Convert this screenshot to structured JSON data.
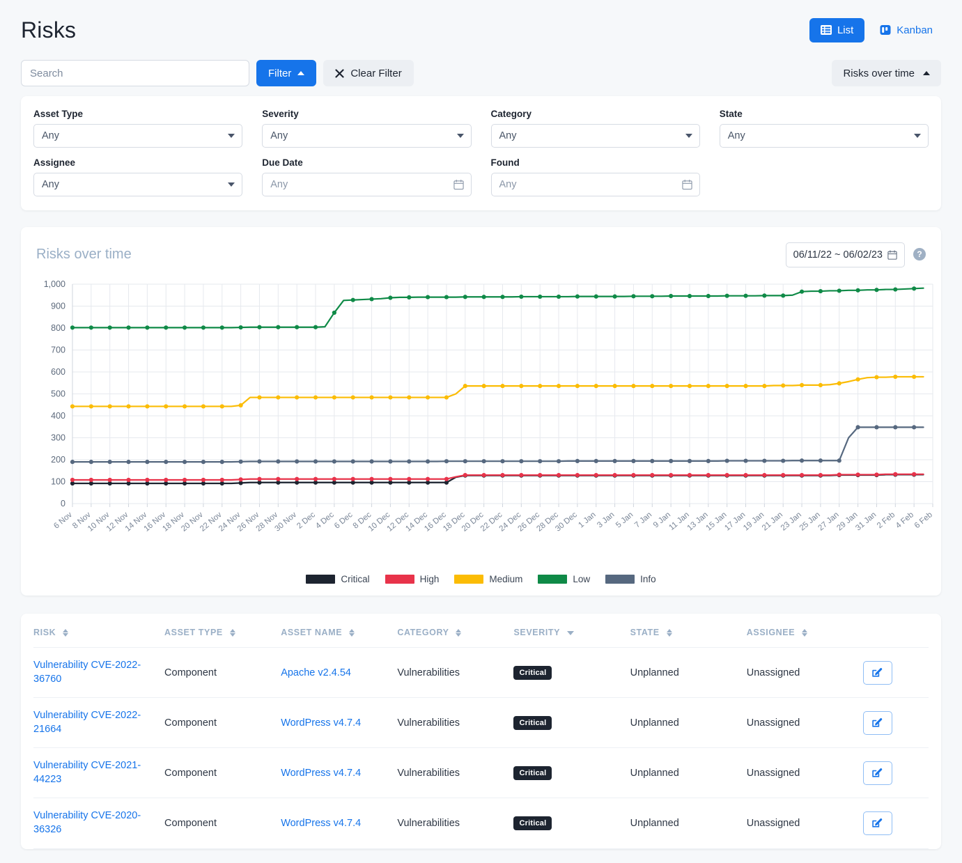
{
  "header": {
    "title": "Risks",
    "views": [
      {
        "label": "List",
        "icon": "list-icon",
        "active": true
      },
      {
        "label": "Kanban",
        "icon": "kanban-icon",
        "active": false
      }
    ]
  },
  "toolbar": {
    "search_placeholder": "Search",
    "search_value": "",
    "filter_label": "Filter",
    "clear_filter_label": "Clear Filter",
    "clear_icon": "close-icon",
    "rotation_label": "Risks over time"
  },
  "filters": [
    {
      "label": "Asset Type",
      "value": "Any",
      "control": "select"
    },
    {
      "label": "Severity",
      "value": "Any",
      "control": "select"
    },
    {
      "label": "Category",
      "value": "Any",
      "control": "select"
    },
    {
      "label": "State",
      "value": "Any",
      "control": "select"
    },
    {
      "label": "Assignee",
      "value": "Any",
      "control": "select"
    },
    {
      "label": "Due Date",
      "value": "Any",
      "control": "date"
    },
    {
      "label": "Found",
      "value": "Any",
      "control": "date"
    }
  ],
  "chart_panel": {
    "title": "Risks over time",
    "date_range": "06/11/22 ~ 06/02/23",
    "calendar_icon": "calendar-icon",
    "help_icon": "help-icon",
    "help_glyph": "?"
  },
  "chart_data": {
    "type": "line",
    "title": "Risks over time",
    "xlabel": "",
    "ylabel": "",
    "ylim": [
      0,
      1000
    ],
    "ytick_labels": [
      "0",
      "100",
      "200",
      "300",
      "400",
      "500",
      "600",
      "700",
      "800",
      "900",
      "1,000"
    ],
    "yticks": [
      0,
      100,
      200,
      300,
      400,
      500,
      600,
      700,
      800,
      900,
      1000
    ],
    "grid": true,
    "legend_position": "bottom",
    "x": [
      "6 Nov",
      "7 Nov",
      "8 Nov",
      "9 Nov",
      "10 Nov",
      "11 Nov",
      "12 Nov",
      "13 Nov",
      "14 Nov",
      "15 Nov",
      "16 Nov",
      "17 Nov",
      "18 Nov",
      "19 Nov",
      "20 Nov",
      "21 Nov",
      "22 Nov",
      "23 Nov",
      "24 Nov",
      "25 Nov",
      "26 Nov",
      "27 Nov",
      "28 Nov",
      "29 Nov",
      "30 Nov",
      "1 Dec",
      "2 Dec",
      "3 Dec",
      "4 Dec",
      "5 Dec",
      "6 Dec",
      "7 Dec",
      "8 Dec",
      "9 Dec",
      "10 Dec",
      "11 Dec",
      "12 Dec",
      "13 Dec",
      "14 Dec",
      "15 Dec",
      "16 Dec",
      "17 Dec",
      "18 Dec",
      "19 Dec",
      "20 Dec",
      "21 Dec",
      "22 Dec",
      "23 Dec",
      "24 Dec",
      "25 Dec",
      "26 Dec",
      "27 Dec",
      "28 Dec",
      "29 Dec",
      "30 Dec",
      "31 Dec",
      "1 Jan",
      "2 Jan",
      "3 Jan",
      "4 Jan",
      "5 Jan",
      "6 Jan",
      "7 Jan",
      "8 Jan",
      "9 Jan",
      "10 Jan",
      "11 Jan",
      "12 Jan",
      "13 Jan",
      "14 Jan",
      "15 Jan",
      "16 Jan",
      "17 Jan",
      "18 Jan",
      "19 Jan",
      "20 Jan",
      "21 Jan",
      "22 Jan",
      "23 Jan",
      "24 Jan",
      "25 Jan",
      "26 Jan",
      "27 Jan",
      "28 Jan",
      "29 Jan",
      "30 Jan",
      "31 Jan",
      "1 Feb",
      "2 Feb",
      "3 Feb",
      "4 Feb",
      "5 Feb",
      "6 Feb"
    ],
    "xtick_labels": [
      "6 Nov",
      "8 Nov",
      "10 Nov",
      "12 Nov",
      "14 Nov",
      "16 Nov",
      "18 Nov",
      "20 Nov",
      "22 Nov",
      "24 Nov",
      "26 Nov",
      "28 Nov",
      "30 Nov",
      "2 Dec",
      "4 Dec",
      "6 Dec",
      "8 Dec",
      "10 Dec",
      "12 Dec",
      "14 Dec",
      "16 Dec",
      "18 Dec",
      "20 Dec",
      "22 Dec",
      "24 Dec",
      "26 Dec",
      "28 Dec",
      "30 Dec",
      "1 Jan",
      "3 Jan",
      "5 Jan",
      "7 Jan",
      "9 Jan",
      "11 Jan",
      "13 Jan",
      "15 Jan",
      "17 Jan",
      "19 Jan",
      "21 Jan",
      "23 Jan",
      "25 Jan",
      "27 Jan",
      "29 Jan",
      "31 Jan",
      "2 Feb",
      "4 Feb",
      "6 Feb"
    ],
    "series": [
      {
        "name": "Critical",
        "color": "#1d2430",
        "values": [
          92,
          92,
          92,
          92,
          92,
          92,
          92,
          92,
          92,
          92,
          92,
          92,
          92,
          92,
          92,
          92,
          92,
          92,
          94,
          96,
          96,
          96,
          96,
          96,
          96,
          96,
          96,
          96,
          96,
          96,
          96,
          96,
          96,
          96,
          96,
          96,
          96,
          96,
          96,
          96,
          96,
          120,
          128,
          128,
          128,
          128,
          128,
          128,
          128,
          128,
          128,
          128,
          128,
          128,
          128,
          128,
          128,
          128,
          128,
          128,
          128,
          128,
          128,
          128,
          128,
          128,
          128,
          128,
          128,
          128,
          128,
          128,
          128,
          128,
          128,
          128,
          128,
          128,
          128,
          128,
          128,
          128,
          130,
          130,
          130,
          130,
          130,
          132,
          132,
          132,
          132,
          132
        ]
      },
      {
        "name": "High",
        "color": "#e8334a",
        "values": [
          108,
          108,
          108,
          108,
          108,
          108,
          108,
          108,
          108,
          108,
          108,
          108,
          108,
          108,
          108,
          108,
          108,
          108,
          110,
          112,
          112,
          112,
          112,
          112,
          112,
          112,
          112,
          112,
          112,
          112,
          112,
          112,
          112,
          112,
          112,
          112,
          112,
          112,
          112,
          112,
          112,
          122,
          130,
          130,
          130,
          130,
          130,
          130,
          130,
          130,
          130,
          130,
          130,
          130,
          130,
          130,
          130,
          130,
          130,
          130,
          130,
          130,
          130,
          130,
          130,
          130,
          130,
          130,
          130,
          130,
          130,
          130,
          130,
          130,
          130,
          130,
          130,
          130,
          130,
          130,
          130,
          130,
          132,
          132,
          132,
          132,
          132,
          134,
          134,
          134,
          134,
          134
        ]
      },
      {
        "name": "Medium",
        "color": "#fbbc05",
        "values": [
          443,
          443,
          443,
          443,
          443,
          443,
          443,
          443,
          443,
          443,
          443,
          443,
          443,
          443,
          443,
          443,
          443,
          443,
          448,
          484,
          484,
          484,
          484,
          484,
          484,
          484,
          484,
          484,
          484,
          484,
          484,
          484,
          484,
          484,
          484,
          484,
          484,
          484,
          484,
          484,
          484,
          500,
          536,
          536,
          536,
          536,
          536,
          536,
          536,
          536,
          536,
          536,
          536,
          536,
          536,
          536,
          536,
          536,
          536,
          536,
          536,
          536,
          536,
          536,
          536,
          536,
          536,
          536,
          536,
          536,
          536,
          536,
          536,
          536,
          536,
          538,
          538,
          538,
          540,
          540,
          540,
          542,
          548,
          556,
          566,
          574,
          576,
          576,
          578,
          578,
          578,
          578
        ]
      },
      {
        "name": "Low",
        "color": "#0f8a47",
        "values": [
          802,
          802,
          802,
          802,
          802,
          802,
          802,
          802,
          802,
          802,
          802,
          802,
          802,
          802,
          802,
          802,
          802,
          802,
          803,
          804,
          804,
          804,
          804,
          804,
          804,
          804,
          804,
          806,
          870,
          926,
          928,
          930,
          932,
          934,
          938,
          940,
          940,
          941,
          941,
          941,
          941,
          941,
          942,
          942,
          942,
          942,
          942,
          942,
          943,
          943,
          943,
          943,
          943,
          943,
          944,
          944,
          944,
          944,
          944,
          944,
          945,
          945,
          945,
          945,
          946,
          946,
          946,
          946,
          946,
          946,
          947,
          947,
          947,
          947,
          948,
          948,
          948,
          950,
          966,
          968,
          968,
          970,
          970,
          972,
          972,
          974,
          974,
          976,
          976,
          978,
          980,
          982
        ]
      },
      {
        "name": "Info",
        "color": "#56687f",
        "values": [
          190,
          190,
          190,
          190,
          190,
          190,
          190,
          190,
          190,
          190,
          190,
          190,
          190,
          190,
          190,
          190,
          190,
          190,
          191,
          192,
          192,
          192,
          192,
          192,
          192,
          192,
          192,
          192,
          192,
          192,
          192,
          192,
          192,
          192,
          192,
          192,
          192,
          192,
          192,
          192,
          193,
          193,
          193,
          193,
          193,
          193,
          193,
          193,
          193,
          193,
          193,
          193,
          193,
          194,
          194,
          194,
          194,
          194,
          194,
          194,
          194,
          194,
          194,
          194,
          194,
          194,
          194,
          194,
          194,
          194,
          195,
          195,
          195,
          195,
          195,
          195,
          195,
          196,
          196,
          196,
          196,
          196,
          196,
          300,
          348,
          348,
          348,
          348,
          348,
          348,
          348,
          348
        ]
      }
    ],
    "legend": [
      {
        "label": "Critical",
        "color": "#1d2430"
      },
      {
        "label": "High",
        "color": "#e8334a"
      },
      {
        "label": "Medium",
        "color": "#fbbc05"
      },
      {
        "label": "Low",
        "color": "#0f8a47"
      },
      {
        "label": "Info",
        "color": "#56687f"
      }
    ]
  },
  "table": {
    "columns": [
      {
        "label": "RISK",
        "sort": "none"
      },
      {
        "label": "ASSET TYPE",
        "sort": "none"
      },
      {
        "label": "ASSET NAME",
        "sort": "none"
      },
      {
        "label": "CATEGORY",
        "sort": "none"
      },
      {
        "label": "SEVERITY",
        "sort": "desc"
      },
      {
        "label": "STATE",
        "sort": "none"
      },
      {
        "label": "ASSIGNEE",
        "sort": "none"
      },
      {
        "label": "",
        "sort": "none"
      }
    ],
    "rows": [
      {
        "risk": "Vulnerability CVE-2022-36760",
        "asset_type": "Component",
        "asset_name": "Apache v2.4.54",
        "category": "Vulnerabilities",
        "severity": "Critical",
        "state": "Unplanned",
        "assignee": "Unassigned",
        "action_icon": "edit-icon"
      },
      {
        "risk": "Vulnerability CVE-2022-21664",
        "asset_type": "Component",
        "asset_name": "WordPress v4.7.4",
        "category": "Vulnerabilities",
        "severity": "Critical",
        "state": "Unplanned",
        "assignee": "Unassigned",
        "action_icon": "edit-icon"
      },
      {
        "risk": "Vulnerability CVE-2021-44223",
        "asset_type": "Component",
        "asset_name": "WordPress v4.7.4",
        "category": "Vulnerabilities",
        "severity": "Critical",
        "state": "Unplanned",
        "assignee": "Unassigned",
        "action_icon": "edit-icon"
      },
      {
        "risk": "Vulnerability CVE-2020-36326",
        "asset_type": "Component",
        "asset_name": "WordPress v4.7.4",
        "category": "Vulnerabilities",
        "severity": "Critical",
        "state": "Unplanned",
        "assignee": "Unassigned",
        "action_icon": "edit-icon"
      }
    ]
  },
  "colors": {
    "accent": "#1674ea",
    "page_bg": "#f6f8fa",
    "muted": "#9aafc6"
  }
}
